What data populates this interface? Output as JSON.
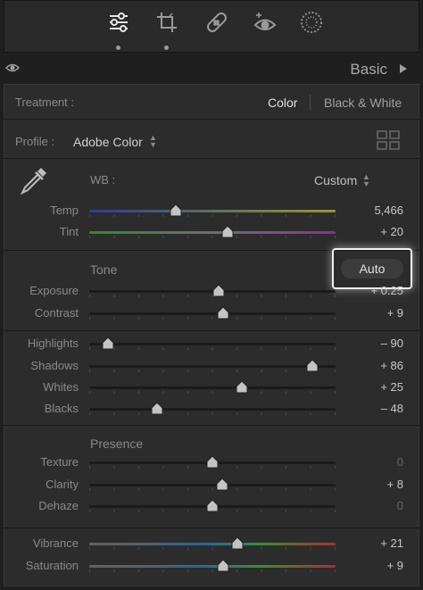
{
  "toolstrip": {
    "tools": [
      {
        "name": "edit-sliders-icon",
        "active": true
      },
      {
        "name": "crop-icon",
        "active": false
      },
      {
        "name": "healing-icon",
        "active": false
      },
      {
        "name": "red-eye-icon",
        "active": false
      },
      {
        "name": "masking-icon",
        "active": false
      }
    ]
  },
  "header": {
    "title": "Basic"
  },
  "treatment": {
    "label": "Treatment :",
    "options": [
      "Color",
      "Black & White"
    ],
    "selected": "Color"
  },
  "profile": {
    "label": "Profile :",
    "value": "Adobe Color"
  },
  "wb": {
    "label": "WB :",
    "value": "Custom"
  },
  "tone": {
    "title": "Tone",
    "auto_label": "Auto"
  },
  "presence": {
    "title": "Presence"
  },
  "sliders": [
    {
      "key": "temp",
      "label": "Temp",
      "value": "5,466",
      "fraction": 0.35,
      "track": "temp"
    },
    {
      "key": "tint",
      "label": "Tint",
      "value": "+ 20",
      "fraction": 0.56,
      "track": "tint"
    },
    {
      "key": "exposure",
      "label": "Exposure",
      "value": "+ 0.25",
      "fraction": 0.525,
      "track": "plain"
    },
    {
      "key": "contrast",
      "label": "Contrast",
      "value": "+ 9",
      "fraction": 0.545,
      "track": "plain"
    },
    {
      "key": "highlights",
      "label": "Highlights",
      "value": "– 90",
      "fraction": 0.075,
      "track": "plain"
    },
    {
      "key": "shadows",
      "label": "Shadows",
      "value": "+ 86",
      "fraction": 0.905,
      "track": "plain"
    },
    {
      "key": "whites",
      "label": "Whites",
      "value": "+ 25",
      "fraction": 0.62,
      "track": "plain"
    },
    {
      "key": "blacks",
      "label": "Blacks",
      "value": "– 48",
      "fraction": 0.275,
      "track": "plain"
    },
    {
      "key": "texture",
      "label": "Texture",
      "value": "0",
      "fraction": 0.5,
      "track": "plain",
      "dim": true
    },
    {
      "key": "clarity",
      "label": "Clarity",
      "value": "+ 8",
      "fraction": 0.54,
      "track": "plain"
    },
    {
      "key": "dehaze",
      "label": "Dehaze",
      "value": "0",
      "fraction": 0.5,
      "track": "plain",
      "dim": true
    },
    {
      "key": "vibrance",
      "label": "Vibrance",
      "value": "+ 21",
      "fraction": 0.6,
      "track": "vibrance"
    },
    {
      "key": "saturation",
      "label": "Saturation",
      "value": "+ 9",
      "fraction": 0.545,
      "track": "saturation"
    }
  ],
  "colors": {
    "panel_bg": "#2c2c2c",
    "auto_highlight": "#f0f0f0",
    "temp_track": [
      "#2a3a9a",
      "#8a8a30"
    ],
    "tint_track": [
      "#2f8a2f",
      "#8a2f8a"
    ],
    "vibrance_track": [
      "#6a6a6a",
      "#2a6a9a",
      "#3a9a3a",
      "#9a3a3a"
    ]
  }
}
